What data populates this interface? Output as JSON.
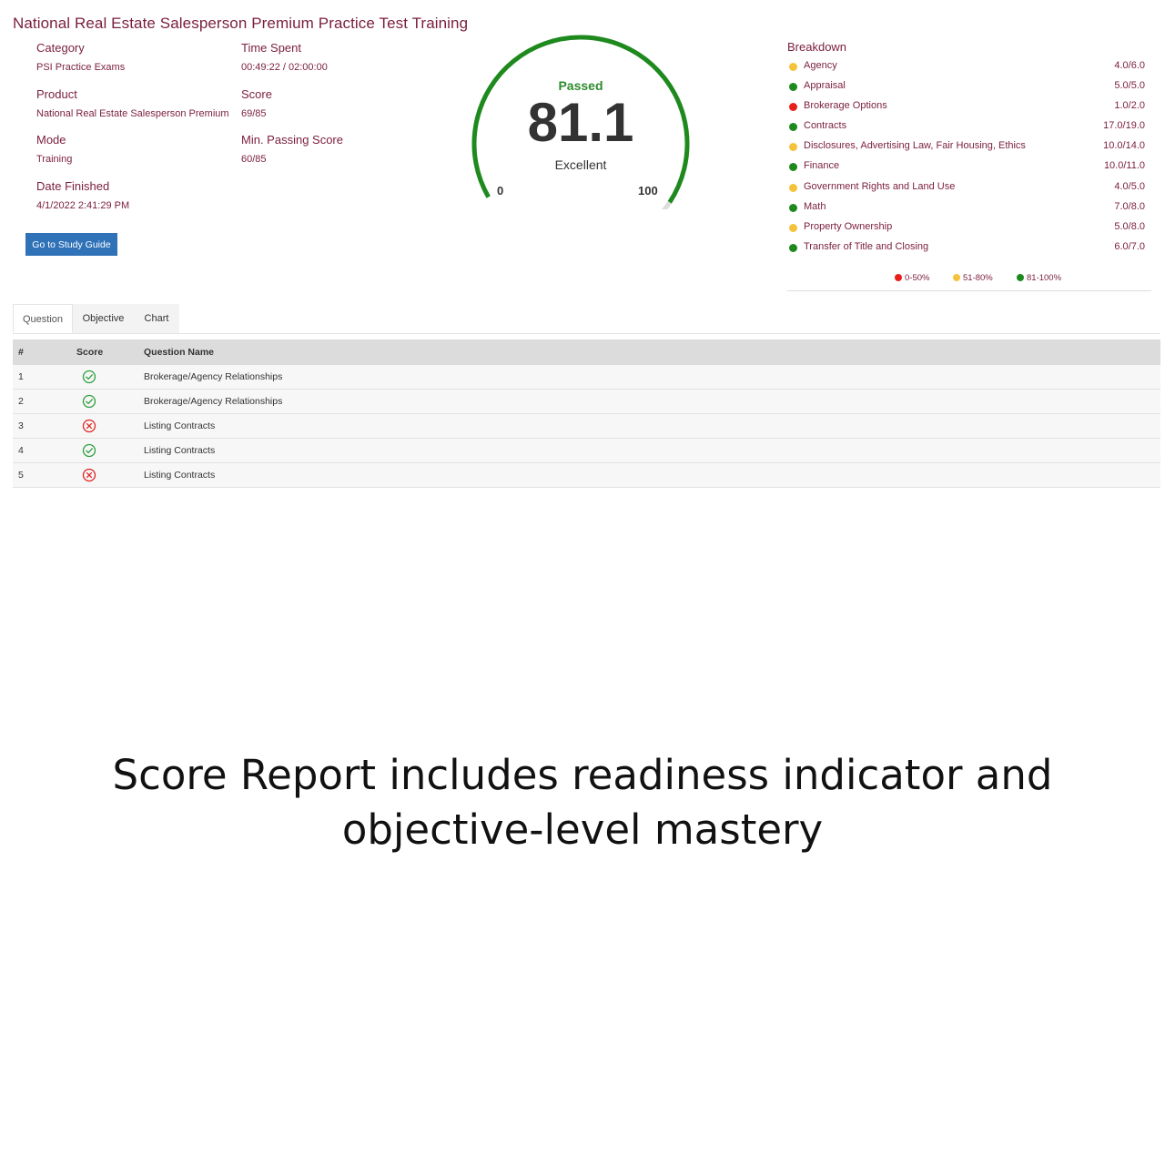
{
  "page": {
    "title": "National Real Estate Salesperson Premium Practice Test Training"
  },
  "info": {
    "category": {
      "label": "Category",
      "value": "PSI Practice Exams"
    },
    "time_spent": {
      "label": "Time Spent",
      "value": "00:49:22 / 02:00:00"
    },
    "product": {
      "label": "Product",
      "value": "National Real Estate Salesperson Premium"
    },
    "score": {
      "label": "Score",
      "value": "69/85"
    },
    "mode": {
      "label": "Mode",
      "value": "Training"
    },
    "min_passing": {
      "label": "Min. Passing Score",
      "value": "60/85"
    },
    "date_finished": {
      "label": "Date Finished",
      "value": "4/1/2022 2:41:29 PM"
    }
  },
  "study_button": {
    "label": "Go to Study Guide"
  },
  "gauge": {
    "status": "Passed",
    "value": "81.1",
    "value_numeric": 81.1,
    "rating": "Excellent",
    "min": "0",
    "max": "100",
    "min_numeric": 0,
    "max_numeric": 100,
    "fill_color": "#1e8a1e",
    "track_color": "#dddddd"
  },
  "breakdown": {
    "title": "Breakdown",
    "items": [
      {
        "name": "Agency",
        "score": "4.0/6.0",
        "color": "#f5c33b"
      },
      {
        "name": "Appraisal",
        "score": "5.0/5.0",
        "color": "#1e8a1e"
      },
      {
        "name": "Brokerage Options",
        "score": "1.0/2.0",
        "color": "#e8201c"
      },
      {
        "name": "Contracts",
        "score": "17.0/19.0",
        "color": "#1e8a1e"
      },
      {
        "name": "Disclosures, Advertising Law, Fair Housing, Ethics",
        "score": "10.0/14.0",
        "color": "#f5c33b"
      },
      {
        "name": "Finance",
        "score": "10.0/11.0",
        "color": "#1e8a1e"
      },
      {
        "name": "Government Rights and Land Use",
        "score": "4.0/5.0",
        "color": "#f5c33b"
      },
      {
        "name": "Math",
        "score": "7.0/8.0",
        "color": "#1e8a1e"
      },
      {
        "name": "Property Ownership",
        "score": "5.0/8.0",
        "color": "#f5c33b"
      },
      {
        "name": "Transfer of Title and Closing",
        "score": "6.0/7.0",
        "color": "#1e8a1e"
      }
    ],
    "legend": [
      {
        "label": "0-50%",
        "color": "#e8201c"
      },
      {
        "label": "51-80%",
        "color": "#f5c33b"
      },
      {
        "label": "81-100%",
        "color": "#1e8a1e"
      }
    ]
  },
  "tabs": [
    {
      "label": "Question",
      "active": true
    },
    {
      "label": "Objective",
      "active": false
    },
    {
      "label": "Chart",
      "active": false
    }
  ],
  "table": {
    "headers": {
      "num": "#",
      "score": "Score",
      "name": "Question Name"
    },
    "rows": [
      {
        "num": "1",
        "correct": true,
        "name": "Brokerage/Agency Relationships"
      },
      {
        "num": "2",
        "correct": true,
        "name": "Brokerage/Agency Relationships"
      },
      {
        "num": "3",
        "correct": false,
        "name": "Listing Contracts"
      },
      {
        "num": "4",
        "correct": true,
        "name": "Listing Contracts"
      },
      {
        "num": "5",
        "correct": false,
        "name": "Listing Contracts"
      }
    ],
    "icons": {
      "correct": "check-circle-icon",
      "incorrect": "x-circle-icon"
    },
    "colors": {
      "correct": "#2e9e3e",
      "incorrect": "#e02424"
    }
  },
  "caption": {
    "line1": "Score Report includes readiness indicator and",
    "line2": "objective-level mastery"
  }
}
